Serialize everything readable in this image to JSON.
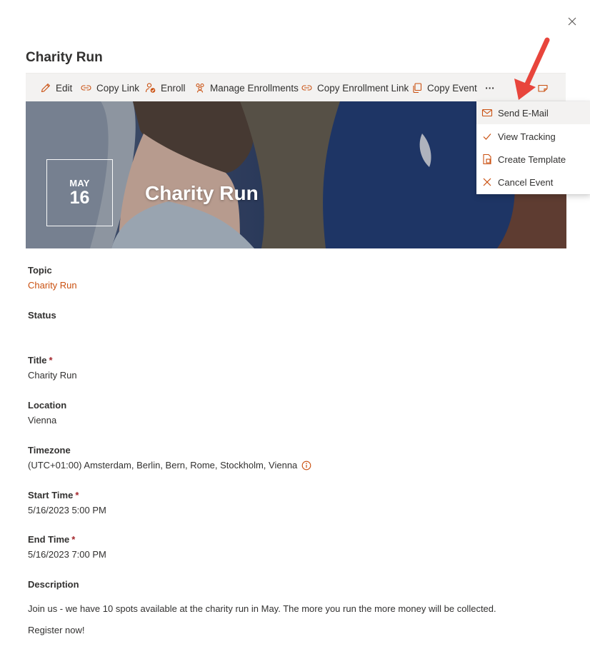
{
  "dialog": {
    "title": "Charity Run",
    "close_icon": "close-icon"
  },
  "toolbar": {
    "edit": "Edit",
    "copy_link": "Copy Link",
    "enroll": "Enroll",
    "manage_enrollments": "Manage Enrollments",
    "copy_enrollment_link": "Copy Enrollment Link",
    "copy_event": "Copy Event",
    "more": "···"
  },
  "hero": {
    "month": "MAY",
    "day": "16",
    "title": "Charity Run"
  },
  "menu": {
    "items": [
      {
        "label": "Send E-Mail",
        "icon": "mail-icon"
      },
      {
        "label": "View Tracking",
        "icon": "check-icon"
      },
      {
        "label": "Create Template",
        "icon": "template-icon"
      },
      {
        "label": "Cancel Event",
        "icon": "cancel-icon"
      }
    ]
  },
  "fields": {
    "topic": {
      "label": "Topic",
      "value": "Charity Run"
    },
    "status": {
      "label": "Status",
      "value": ""
    },
    "title": {
      "label": "Title",
      "value": "Charity Run"
    },
    "location": {
      "label": "Location",
      "value": "Vienna"
    },
    "timezone": {
      "label": "Timezone",
      "value": "(UTC+01:00) Amsterdam, Berlin, Bern, Rome, Stockholm, Vienna"
    },
    "start_time": {
      "label": "Start Time",
      "value": "5/16/2023 5:00 PM"
    },
    "end_time": {
      "label": "End Time",
      "value": "5/16/2023 7:00 PM"
    },
    "description": {
      "label": "Description"
    }
  },
  "required_marker": "*",
  "description": {
    "paragraph1": "Join us - we have 10 spots available at the charity run in May. The more you run the more money will be collected.",
    "paragraph2": "Register now!"
  },
  "colors": {
    "accent": "#ca5010",
    "annotation_arrow": "#e8453c"
  }
}
